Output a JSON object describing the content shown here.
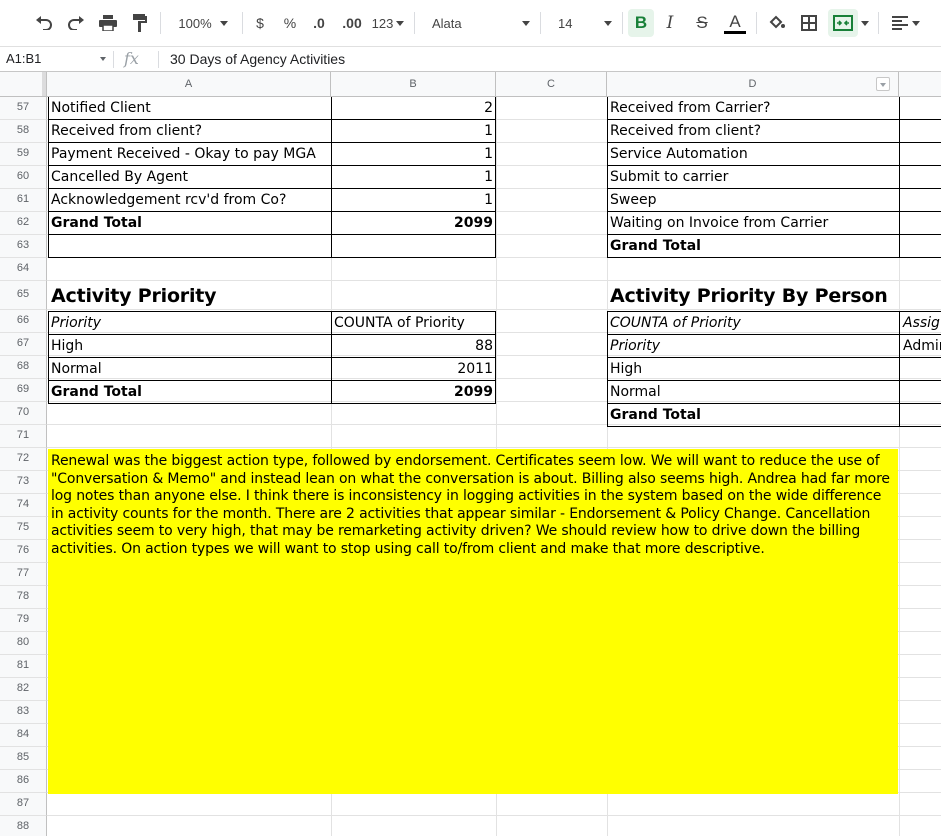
{
  "toolbar": {
    "zoom": "100%",
    "currency": "$",
    "percent": "%",
    "dec_decrease": ".0",
    "dec_increase": ".00",
    "number_format": "123",
    "font_name": "Alata",
    "font_size": "14",
    "bold": "B",
    "italic": "I",
    "strike": "S",
    "text_color": "A"
  },
  "formula_bar": {
    "name_box": "A1:B1",
    "fx": "fx",
    "content": "30 Days of Agency Activities"
  },
  "columns": [
    "A",
    "B",
    "C",
    "D"
  ],
  "rows": [
    "57",
    "58",
    "59",
    "60",
    "61",
    "62",
    "63",
    "64",
    "65",
    "66",
    "67",
    "68",
    "69",
    "70",
    "71",
    "72",
    "73",
    "74",
    "75",
    "76",
    "77",
    "78",
    "79",
    "80",
    "81",
    "82",
    "83",
    "84",
    "85",
    "86",
    "87",
    "88"
  ],
  "table_top_left": [
    {
      "label": "Notified Client",
      "value": "2"
    },
    {
      "label": "Received from client?",
      "value": "1"
    },
    {
      "label": "Payment Received - Okay to pay MGA",
      "value": "1"
    },
    {
      "label": "Cancelled By Agent",
      "value": "1"
    },
    {
      "label": "Acknowledgement rcv'd from Co?",
      "value": "1"
    },
    {
      "label": "Grand Total",
      "value": "2099"
    }
  ],
  "table_top_right": [
    "Received from Carrier?",
    "Received from client?",
    "Service Automation",
    "Submit to carrier",
    "Sweep",
    "Waiting on Invoice from Carrier",
    "Grand Total"
  ],
  "activity_priority": {
    "title": "Activity Priority",
    "header_label": "Priority",
    "header_value": "COUNTA of Priority",
    "rows": [
      {
        "label": "High",
        "value": "88"
      },
      {
        "label": "Normal",
        "value": "2011"
      },
      {
        "label": "Grand Total",
        "value": "2099"
      }
    ]
  },
  "activity_priority_person": {
    "title": "Activity Priority By Person",
    "header": "COUNTA of Priority",
    "header_e": "Assig",
    "subheader": "Priority",
    "subheader_e": "Admir",
    "rows": [
      "High",
      "Normal",
      "Grand Total"
    ]
  },
  "note": "Renewal was the biggest action type, followed by endorsement. Certificates seem low. We will want to reduce the use of \"Conversation & Memo\" and instead lean on what the conversation is about. Billing also seems high. Andrea had far more log notes than anyone else. I think there is inconsistency in logging activities in the system based on the wide difference in activity counts for the month. There are 2 activities that appear similar - Endorsement & Policy Change.  Cancellation activities seem to very high, that may be remarketing activity driven? We should review how to drive down the billing activities. On action types we will want to stop using call to/from client and make that more descriptive.",
  "colors": {
    "highlight": "#ffff00",
    "header_bg": "#f8f9fa",
    "active_btn": "#e6f4ea"
  }
}
